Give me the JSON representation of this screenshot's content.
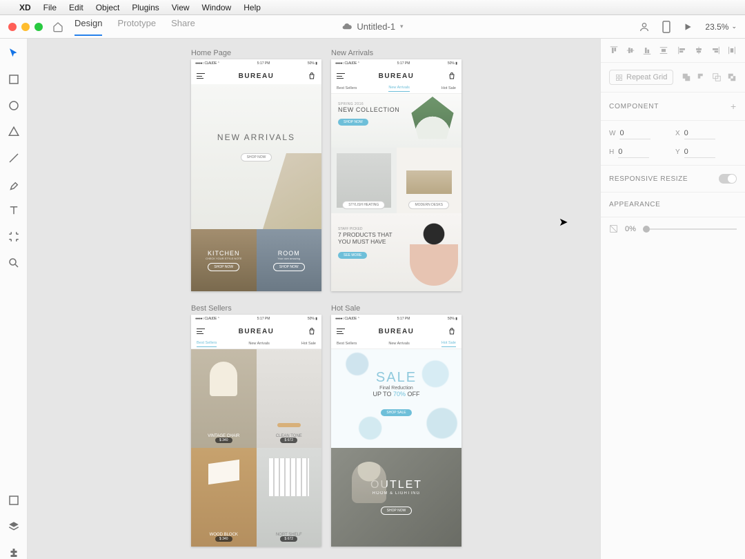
{
  "menubar": {
    "items": [
      "XD",
      "File",
      "Edit",
      "Object",
      "Plugins",
      "View",
      "Window",
      "Help"
    ]
  },
  "apptool": {
    "modes": [
      "Design",
      "Prototype",
      "Share"
    ],
    "active_mode": "Design",
    "doc_title": "Untitled-1",
    "zoom": "23.5%"
  },
  "left_tools": [
    "select",
    "rectangle",
    "ellipse",
    "polygon",
    "line",
    "pen",
    "text",
    "artboard",
    "zoom"
  ],
  "left_bottom": [
    "layers",
    "assets",
    "plugins"
  ],
  "right": {
    "repeat_label": "Repeat Grid",
    "component_label": "COMPONENT",
    "dims": {
      "W": "0",
      "H": "0",
      "X": "0",
      "Y": "0"
    },
    "responsive_label": "RESPONSIVE RESIZE",
    "appearance_label": "APPEARANCE",
    "opacity": "0%"
  },
  "artboards": {
    "status": {
      "carrier": "CLAUDE",
      "time": "5:17 PM",
      "battery": "50%"
    },
    "brand": "BUREAU",
    "nav": [
      "Best Sellers",
      "New Arrivals",
      "Hot Sale"
    ],
    "home": {
      "title": "Home Page",
      "hero_title": "NEW ARRIVALS",
      "hero_btn": "SHOP NOW",
      "kitchen": {
        "title": "KITCHEN",
        "sub": "CHECK YOUR STYLE NOTE",
        "btn": "SHOP NOW"
      },
      "room": {
        "title": "ROOM",
        "sub": "Your own amazing",
        "btn": "SHOP NOW"
      }
    },
    "new": {
      "title": "New Arrivals",
      "banner_sup": "SPRING 2016",
      "banner_title": "NEW COLLECTION",
      "banner_btn": "SHOP NOW",
      "pill1": "STYLISH HEATING",
      "pill2": "MODERN DESKS",
      "staff_sup": "STAFF PICKED",
      "staff_title1": "7 PRODUCTS THAT",
      "staff_title2": "YOU MUST HAVE",
      "staff_btn": "SEE MORE"
    },
    "best": {
      "title": "Best Sellers",
      "items": [
        {
          "name": "VINTAGE CHAIR",
          "price": "$ 340"
        },
        {
          "name": "CLEAN TONE",
          "price": "$ 672"
        },
        {
          "name": "WOOD BLOCK",
          "price": "$ 340"
        },
        {
          "name": "NORT SHELF",
          "price": "$ 672"
        }
      ]
    },
    "hot": {
      "title": "Hot Sale",
      "sale_big": "SALE",
      "sale_sub": "Final Reduction",
      "sale_line_pre": "UP TO ",
      "sale_pct": "70%",
      "sale_line_post": " OFF",
      "sale_btn": "SHOP SALE",
      "outlet_title": "OUTLET",
      "outlet_sub": "ROOM & LIGHTING",
      "outlet_btn": "SHOP NOW"
    }
  }
}
